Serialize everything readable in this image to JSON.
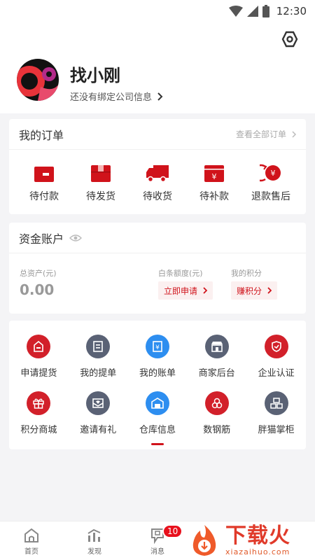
{
  "status_bar": {
    "time": "12:30"
  },
  "profile": {
    "name": "找小刚",
    "company_hint": "还没有绑定公司信息"
  },
  "orders": {
    "title": "我的订单",
    "view_all": "查看全部订单",
    "items": [
      {
        "label": "待付款",
        "icon": "wallet-icon"
      },
      {
        "label": "待发货",
        "icon": "package-box-icon"
      },
      {
        "label": "待收货",
        "icon": "delivery-truck-icon"
      },
      {
        "label": "待补款",
        "icon": "payment-card-icon"
      },
      {
        "label": "退款售后",
        "icon": "refund-icon"
      }
    ]
  },
  "account": {
    "title": "资金账户",
    "total_assets_label": "总资产(元)",
    "total_assets_value": "0.00",
    "credit_label": "白条额度(元)",
    "credit_action": "立即申请",
    "points_label": "我的积分",
    "points_action": "赚积分"
  },
  "services": [
    {
      "label": "申请提货",
      "icon": "pickup-request-icon",
      "color": "#d2202a"
    },
    {
      "label": "我的提单",
      "icon": "bill-of-lading-icon",
      "color": "#5a6275"
    },
    {
      "label": "我的账单",
      "icon": "bill-icon",
      "color": "#2d8ef0"
    },
    {
      "label": "商家后台",
      "icon": "storefront-icon",
      "color": "#5a6275"
    },
    {
      "label": "企业认证",
      "icon": "shield-check-icon",
      "color": "#d2202a"
    },
    {
      "label": "积分商城",
      "icon": "gift-icon",
      "color": "#d2202a"
    },
    {
      "label": "邀请有礼",
      "icon": "invite-envelope-icon",
      "color": "#5a6275"
    },
    {
      "label": "仓库信息",
      "icon": "warehouse-icon",
      "color": "#2d8ef0"
    },
    {
      "label": "数钢筋",
      "icon": "rebar-count-icon",
      "color": "#d2202a"
    },
    {
      "label": "胖猫掌柜",
      "icon": "boxes-icon",
      "color": "#5a6275"
    }
  ],
  "bottom_nav": [
    {
      "label": "首页",
      "icon": "home-icon"
    },
    {
      "label": "发现",
      "icon": "discover-icon"
    },
    {
      "label": "消息",
      "icon": "message-icon",
      "badge": "10"
    }
  ],
  "watermark": {
    "main": "下载火",
    "sub": "xiazaihuo.com"
  },
  "colors": {
    "brand_red": "#d0131b",
    "icon_gray": "#5a6275",
    "icon_blue": "#2d8ef0",
    "page_bg": "#f4f4f6"
  }
}
